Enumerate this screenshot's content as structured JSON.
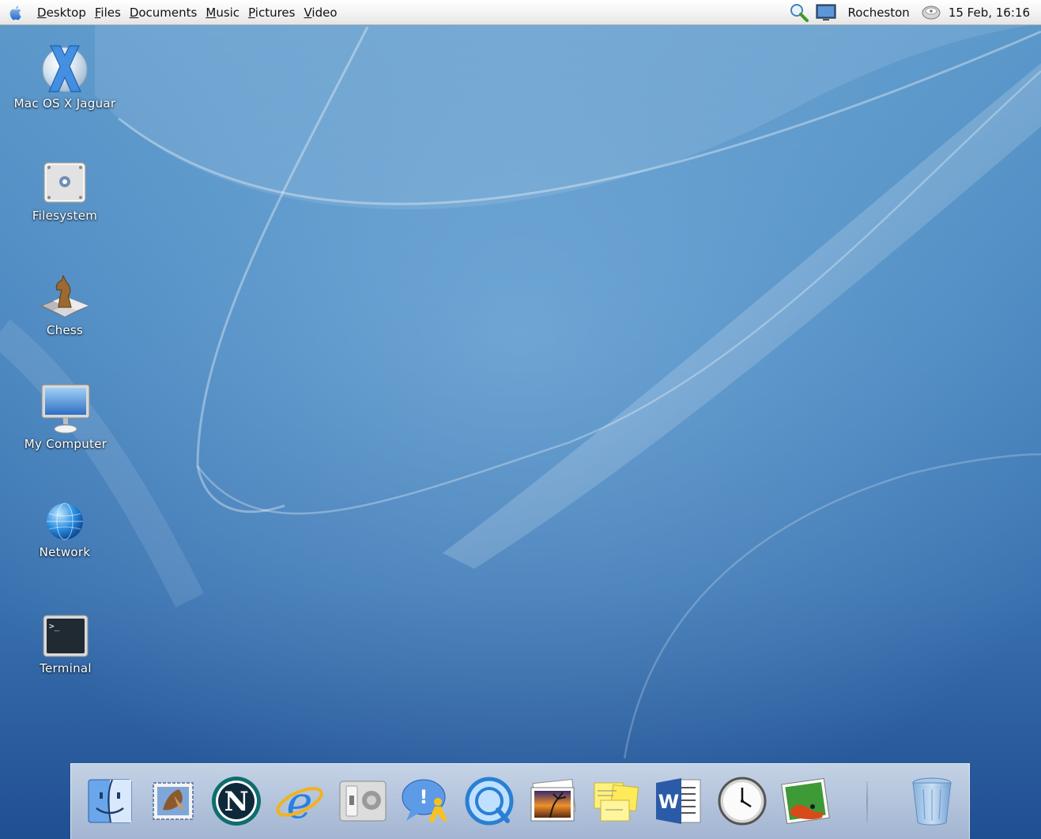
{
  "menubar": {
    "apple_icon": "apple-logo-icon",
    "menus": [
      "Desktop",
      "Files",
      "Documents",
      "Music",
      "Pictures",
      "Video"
    ],
    "user": "Rocheston",
    "clock": "15 Feb, 16:16",
    "icons": [
      "search-icon",
      "display-icon",
      "volume-icon"
    ]
  },
  "desktop": {
    "icons": [
      {
        "label": "Mac OS X Jaguar",
        "icon": "cd-x-icon"
      },
      {
        "label": "Filesystem",
        "icon": "hard-drive-icon"
      },
      {
        "label": "Chess",
        "icon": "chess-knight-icon"
      },
      {
        "label": "My Computer",
        "icon": "imac-icon"
      },
      {
        "label": "Network",
        "icon": "globe-icon"
      },
      {
        "label": "Terminal",
        "icon": "terminal-icon"
      }
    ]
  },
  "dock": {
    "items": [
      "finder-icon",
      "mail-icon",
      "netscape-icon",
      "internet-explorer-icon",
      "system-preferences-icon",
      "ichat-icon",
      "quicktime-icon",
      "iphoto-icon",
      "stickies-icon",
      "word-icon",
      "clock-icon",
      "image-viewer-icon",
      "trash-icon"
    ]
  },
  "colors": {
    "wallpaper_top": "#5e9acb",
    "wallpaper_bottom": "#204f92",
    "menubar": "#f3f3f3"
  }
}
